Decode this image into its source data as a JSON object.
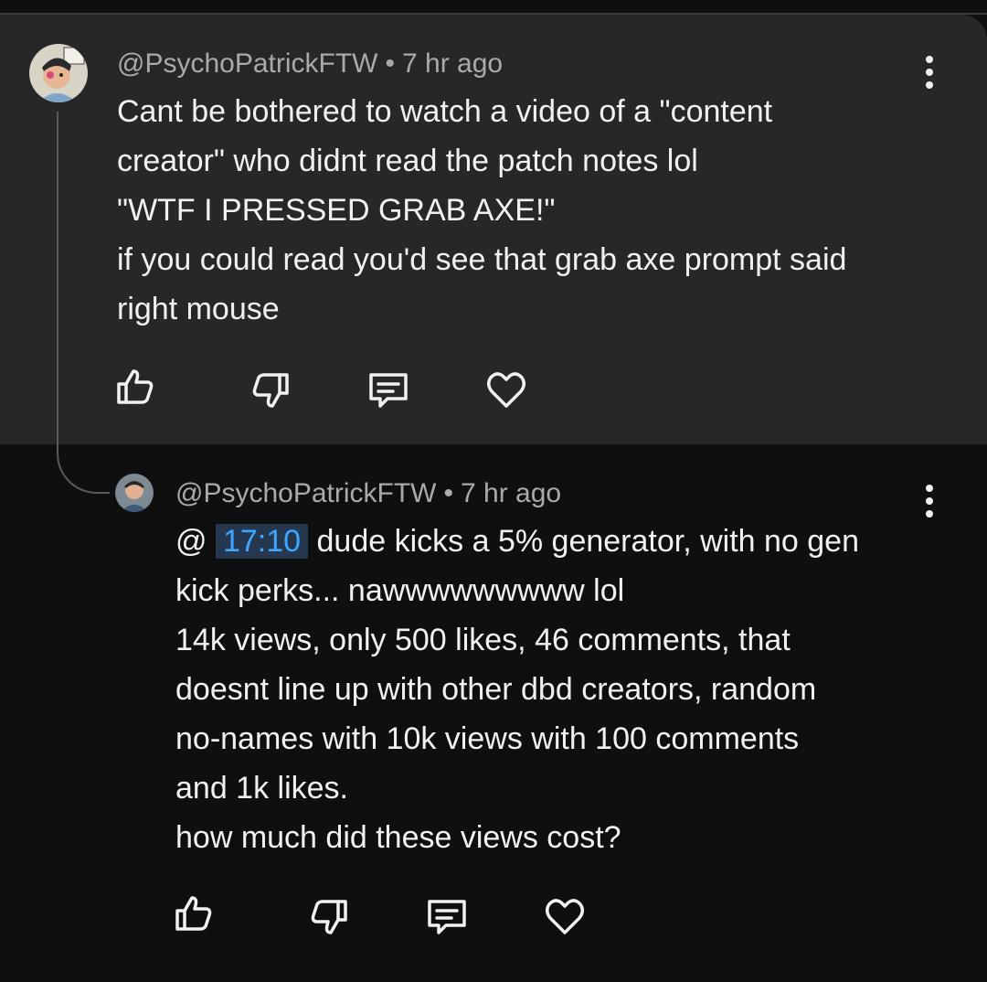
{
  "parent_comment": {
    "author": "@PsychoPatrickFTW",
    "separator": "•",
    "time": "7 hr ago",
    "lines": [
      "Cant be bothered to watch a video of a \"content",
      "creator\" who didnt read the patch notes lol",
      "\"WTF I PRESSED GRAB AXE!\"",
      "if you could read you'd see that grab axe prompt said",
      "right mouse"
    ],
    "avatar_icon": "avatar-icon",
    "actions": [
      "like-icon",
      "dislike-icon",
      "reply-icon",
      "heart-icon"
    ],
    "menu_icon": "more-vert-icon"
  },
  "reply_comment": {
    "author": "@PsychoPatrickFTW",
    "separator": "•",
    "time": "7 hr ago",
    "mention_prefix": "@",
    "timestamp_link": "17:10",
    "first_line_rest": "dude kicks a 5% generator, with no gen",
    "lines": [
      "kick perks... nawwwwwwwww lol",
      "14k views, only 500 likes, 46 comments, that",
      "doesnt line up with other dbd creators, random",
      "no-names with 10k views with 100 comments",
      "and 1k likes.",
      "how much did these views cost?"
    ],
    "avatar_icon": "avatar-icon",
    "actions": [
      "like-icon",
      "dislike-icon",
      "reply-icon",
      "heart-icon"
    ],
    "menu_icon": "more-vert-icon"
  },
  "colors": {
    "background": "#0f0f0f",
    "parent_background": "#272727",
    "text": "#f1f1f1",
    "meta_text": "#aaaaaa",
    "link": "#3ea6ff",
    "link_bg": "#263850"
  }
}
